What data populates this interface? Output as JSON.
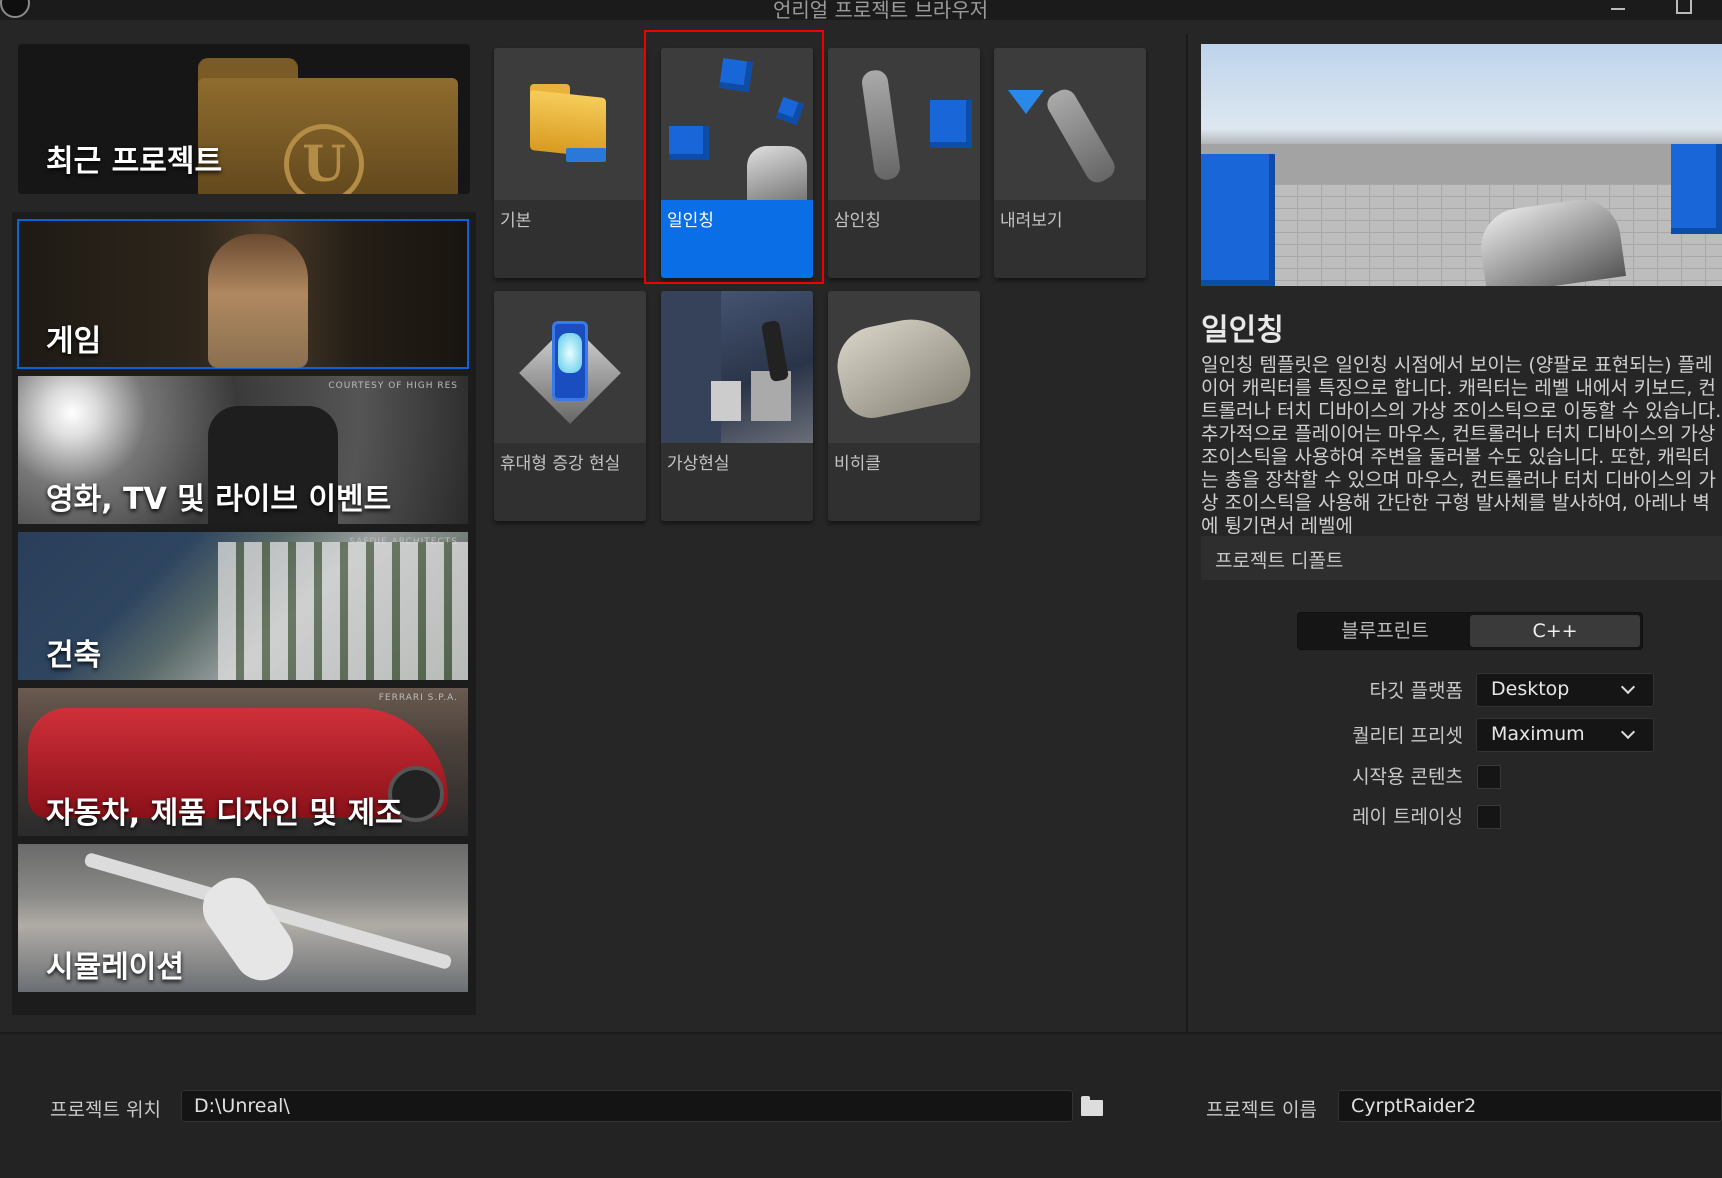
{
  "window": {
    "title": "언리얼 프로젝트 브라우저"
  },
  "sidebar": {
    "recent_label": "최근 프로젝트",
    "categories": [
      {
        "label": "게임",
        "credit": "",
        "selected": true
      },
      {
        "label": "영화, TV 및 라이브 이벤트",
        "credit": "COURTESY OF HIGH RES"
      },
      {
        "label": "건축",
        "credit": "SAFDIE ARCHITECTS"
      },
      {
        "label": "자동차, 제품 디자인 및 제조",
        "credit": "FERRARI S.P.A."
      },
      {
        "label": "시뮬레이션",
        "credit": ""
      }
    ]
  },
  "templates": [
    {
      "label": "기본"
    },
    {
      "label": "일인칭",
      "selected": true
    },
    {
      "label": "삼인칭"
    },
    {
      "label": "내려보기"
    },
    {
      "label": "휴대형 증강 현실"
    },
    {
      "label": "가상현실"
    },
    {
      "label": "비히클"
    }
  ],
  "details": {
    "title": "일인칭",
    "description": "일인칭 템플릿은 일인칭 시점에서 보이는 (양팔로 표현되는) 플레이어 캐릭터를 특징으로 합니다. 캐릭터는 레벨 내에서 키보드, 컨트롤러나 터치 디바이스의 가상 조이스틱으로 이동할 수 있습니다. 추가적으로 플레이어는 마우스, 컨트롤러나 터치 디바이스의 가상 조이스틱을 사용하여 주변을 둘러볼 수도 있습니다. 또한, 캐릭터는 총을 장착할 수 있으며 마우스, 컨트롤러나 터치 디바이스의 가상 조이스틱을 사용해 간단한 구형 발사체를 발사하여, 아레나 벽에 튕기면서 레벨에",
    "section": "프로젝트 디폴트",
    "lang_options": [
      "블루프린트",
      "C++"
    ],
    "lang_selected": "C++",
    "target_platform_label": "타깃 플랫폼",
    "target_platform_value": "Desktop",
    "quality_label": "퀄리티 프리셋",
    "quality_value": "Maximum",
    "starter_label": "시작용 콘텐츠",
    "raytracing_label": "레이 트레이싱"
  },
  "footer": {
    "location_label": "프로젝트 위치",
    "location_value": "D:\\Unreal\\",
    "name_label": "프로젝트 이름",
    "name_value": "CyrptRaider2"
  }
}
